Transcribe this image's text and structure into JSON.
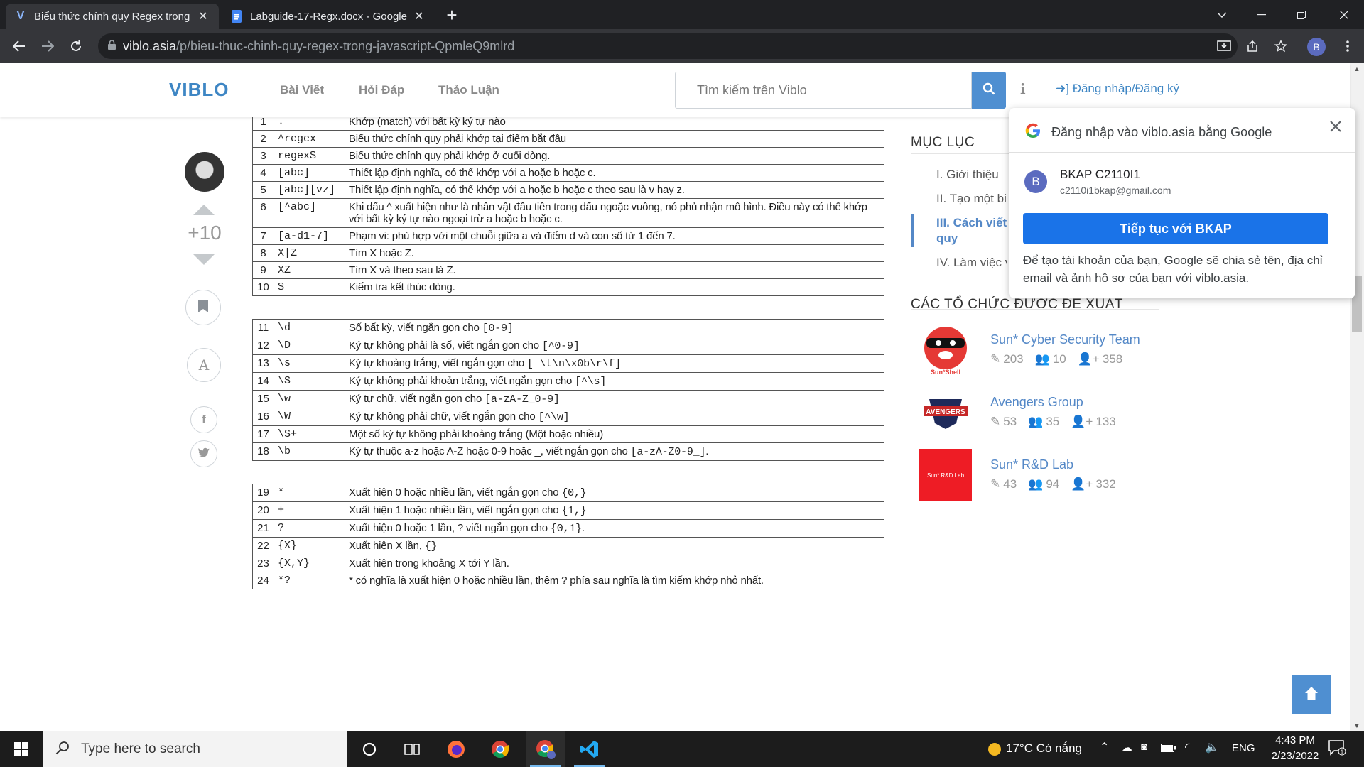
{
  "browser": {
    "tabs": [
      {
        "title": "Biểu thức chính quy Regex trong",
        "favicon": "V"
      },
      {
        "title": "Labguide-17-Regx.docx - Google",
        "favicon": "doc"
      }
    ],
    "url_host": "viblo.asia",
    "url_path": "/p/bieu-thuc-chinh-quy-regex-trong-javascript-QpmleQ9mlrd",
    "profile_initial": "B"
  },
  "header": {
    "logo": "VIBLO",
    "nav": [
      "Bài Viết",
      "Hỏi Đáp",
      "Thảo Luận"
    ],
    "search_placeholder": "Tìm kiếm trên Viblo",
    "info": "i",
    "login": "Đăng nhập/Đăng ký"
  },
  "post": {
    "score": "+10",
    "font_btn": "A"
  },
  "table": {
    "rows": [
      {
        "n": "1",
        "p": ".",
        "d": "Khớp (match) với bất kỳ ký tự nào"
      },
      {
        "n": "2",
        "p": "^regex",
        "d": "Biểu thức chính quy phải  khớp tại điểm bắt đầu"
      },
      {
        "n": "3",
        "p": "regex$",
        "d": "Biểu thức chính quy phải khớp ở cuối dòng."
      },
      {
        "n": "4",
        "p": "[abc]",
        "d": "Thiết lập định nghĩa, có thể khớp với a hoặc b hoặc c."
      },
      {
        "n": "5",
        "p": "[abc][vz]",
        "d": "Thiết lập định nghĩa, có thể khớp với a hoặc b hoặc c theo sau là v hay z."
      },
      {
        "n": "6",
        "p": "[^abc]",
        "d": "Khi dấu ^ xuất hiện như là nhân vật đầu tiên trong dấu ngoặc vuông, nó phủ nhận mô hình. Điều này có thể khớp với bất kỳ ký tự nào ngoại trừ a hoặc b hoặc c."
      },
      {
        "n": "7",
        "p": "[a-d1-7]",
        "d": "Phạm vi: phù hợp với một chuỗi giữa a và điểm d và con số từ 1 đến 7."
      },
      {
        "n": "8",
        "p": "X|Z",
        "d": "Tìm X hoặc Z."
      },
      {
        "n": "9",
        "p": "XZ",
        "d": "Tìm X và theo sau là Z."
      },
      {
        "n": "10",
        "p": "$",
        "d": "Kiểm tra kết thúc dòng."
      },
      {
        "gap": true
      },
      {
        "n": "11",
        "p": "\\d",
        "d": "Số bất kỳ, viết ngắn gọn cho ",
        "c": "[0-9]"
      },
      {
        "n": "12",
        "p": "\\D",
        "d": "Ký tự không phải là số, viết ngắn gon cho ",
        "c": "[^0-9]"
      },
      {
        "n": "13",
        "p": "\\s",
        "d": "Ký tự khoảng trắng, viết ngắn gọn cho ",
        "c": "[ \\t\\n\\x0b\\r\\f]"
      },
      {
        "n": "14",
        "p": "\\S",
        "d": "Ký tự không phải khoản trắng, viết ngắn gọn cho ",
        "c": "[^\\s]"
      },
      {
        "n": "15",
        "p": "\\w",
        "d": "Ký tự chữ, viết ngắn gọn cho ",
        "c": "[a-zA-Z_0-9]"
      },
      {
        "n": "16",
        "p": "\\W",
        "d": "Ký tự không phải chữ, viết ngắn gọn cho ",
        "c": "[^\\w]"
      },
      {
        "n": "17",
        "p": "\\S+",
        "d": "Một số ký tự không phải khoảng trắng (Một hoặc nhiều)"
      },
      {
        "n": "18",
        "p": "\\b",
        "d": "Ký tự thuộc a-z hoặc A-Z hoặc 0-9 hoặc _, viết ngắn gọn cho ",
        "c": "[a-zA-Z0-9_]",
        "tail": "."
      },
      {
        "gap": true
      },
      {
        "n": "19",
        "p": "*",
        "d": "Xuất hiện 0 hoặc nhiều lần, viết ngắn gọn cho ",
        "c": "{0,}"
      },
      {
        "n": "20",
        "p": "+",
        "d": "Xuất hiện 1 hoặc nhiều lần, viết ngắn gọn cho ",
        "c": "{1,}"
      },
      {
        "n": "21",
        "p": "?",
        "d": "Xuất hiện 0 hoặc 1 lần, ? viết ngắn gọn cho ",
        "c": "{0,1}",
        "tail": "."
      },
      {
        "n": "22",
        "p": "{X}",
        "d": "Xuất hiện X lần, ",
        "c": "{}"
      },
      {
        "n": "23",
        "p": "{X,Y}",
        "d": "Xuất hiện trong khoảng X tới Y lần."
      },
      {
        "n": "24",
        "p": "*?",
        "d": "* có nghĩa là xuất hiện 0 hoặc nhiều lần, thêm ? phía sau nghĩa là tìm kiếm khớp nhỏ nhất."
      }
    ]
  },
  "toc": {
    "title": "MỤC LỤC",
    "items": [
      "I. Giới thiệu",
      "II. Tạo một bi",
      "III. Cách viết",
      "quy",
      "IV. Làm việc v"
    ]
  },
  "orgs": {
    "title": "CÁC TỔ CHỨC ĐƯỢC ĐỀ XUẤT",
    "items": [
      {
        "name": "Sun* Cyber Security Team",
        "posts": "203",
        "members": "10",
        "followers": "358",
        "logo_text": "Sun*Shell",
        "color": "#e53935"
      },
      {
        "name": "Avengers Group",
        "posts": "53",
        "members": "35",
        "followers": "133",
        "logo_text": "AVENGERS",
        "color": "#1e2a5a"
      },
      {
        "name": "Sun* R&D Lab",
        "posts": "43",
        "members": "94",
        "followers": "332",
        "logo_text": "Sun* R&D Lab",
        "color": "#ee1c25"
      }
    ]
  },
  "google_popup": {
    "title": "Đăng nhập vào viblo.asia bằng Google",
    "account_initial": "B",
    "account_name": "BKAP C2110I1",
    "account_email": "c2110i1bkap@gmail.com",
    "button": "Tiếp tục với BKAP",
    "description": "Để tạo tài khoản của bạn, Google sẽ chia sẻ tên, địa chỉ email và ảnh hồ sơ của bạn với viblo.asia."
  },
  "taskbar": {
    "search_placeholder": "Type here to search",
    "weather": "17°C  Có nắng",
    "lang": "ENG",
    "time": "4:43 PM",
    "date": "2/23/2022",
    "notif_count": "1"
  },
  "colors": {
    "accent": "#5488c7",
    "google_blue": "#1a73e8"
  }
}
